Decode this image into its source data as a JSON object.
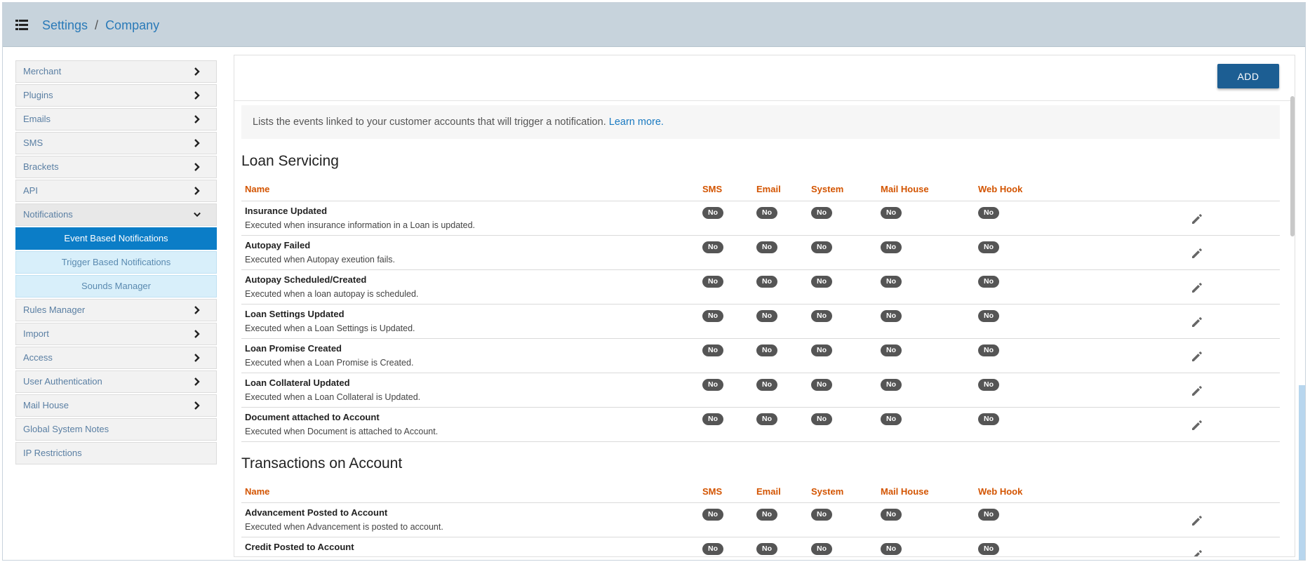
{
  "breadcrumb": {
    "root": "Settings",
    "separator": "/",
    "current": "Company"
  },
  "sidebar": {
    "items": [
      {
        "label": "Merchant",
        "chevron": "right"
      },
      {
        "label": "Plugins",
        "chevron": "right"
      },
      {
        "label": "Emails",
        "chevron": "right"
      },
      {
        "label": "SMS",
        "chevron": "right"
      },
      {
        "label": "Brackets",
        "chevron": "right"
      },
      {
        "label": "API",
        "chevron": "right"
      },
      {
        "label": "Notifications",
        "chevron": "down"
      }
    ],
    "sub_items": [
      {
        "label": "Event Based Notifications",
        "active": true
      },
      {
        "label": "Trigger Based Notifications",
        "active": false
      },
      {
        "label": "Sounds Manager",
        "active": false
      }
    ],
    "items_after": [
      {
        "label": "Rules Manager",
        "chevron": "right"
      },
      {
        "label": "Import",
        "chevron": "right"
      },
      {
        "label": "Access",
        "chevron": "right"
      },
      {
        "label": "User Authentication",
        "chevron": "right"
      },
      {
        "label": "Mail House",
        "chevron": "right"
      },
      {
        "label": "Global System Notes",
        "chevron": ""
      },
      {
        "label": "IP Restrictions",
        "chevron": ""
      }
    ]
  },
  "main": {
    "add_label": "ADD",
    "info_text": "Lists the events linked to your customer accounts that will trigger a notification.",
    "learn_more": "Learn more.",
    "columns": [
      "Name",
      "SMS",
      "Email",
      "System",
      "Mail House",
      "Web Hook"
    ],
    "sections": [
      {
        "title": "Loan Servicing",
        "rows": [
          {
            "title": "Insurance Updated",
            "desc": "Executed when insurance information in a Loan is updated.",
            "values": [
              "No",
              "No",
              "No",
              "No",
              "No"
            ]
          },
          {
            "title": "Autopay Failed",
            "desc": "Executed when Autopay exeution fails.",
            "values": [
              "No",
              "No",
              "No",
              "No",
              "No"
            ]
          },
          {
            "title": "Autopay Scheduled/Created",
            "desc": "Executed when a loan autopay is scheduled.",
            "values": [
              "No",
              "No",
              "No",
              "No",
              "No"
            ]
          },
          {
            "title": "Loan Settings Updated",
            "desc": "Executed when a Loan Settings is Updated.",
            "values": [
              "No",
              "No",
              "No",
              "No",
              "No"
            ]
          },
          {
            "title": "Loan Promise Created",
            "desc": "Executed when a Loan Promise is Created.",
            "values": [
              "No",
              "No",
              "No",
              "No",
              "No"
            ]
          },
          {
            "title": "Loan Collateral Updated",
            "desc": "Executed when a Loan Collateral is Updated.",
            "values": [
              "No",
              "No",
              "No",
              "No",
              "No"
            ]
          },
          {
            "title": "Document attached to Account",
            "desc": "Executed when Document is attached to Account.",
            "values": [
              "No",
              "No",
              "No",
              "No",
              "No"
            ]
          }
        ]
      },
      {
        "title": "Transactions on Account",
        "rows": [
          {
            "title": "Advancement Posted to Account",
            "desc": "Executed when Advancement is posted to account.",
            "values": [
              "No",
              "No",
              "No",
              "No",
              "No"
            ]
          },
          {
            "title": "Credit Posted to Account",
            "desc": "",
            "values": [
              "No",
              "No",
              "No",
              "No",
              "No"
            ]
          }
        ]
      }
    ]
  },
  "colors": {
    "topbar": "#c7d3dc",
    "link": "#2a7ab8",
    "active": "#0b7dc7",
    "header_text": "#d35400",
    "badge": "#555555",
    "button": "#1c5e93"
  },
  "icons": {
    "menu": "list-icon",
    "chevron_right": "chevron-right-icon",
    "chevron_down": "chevron-down-icon",
    "edit": "pencil-icon"
  }
}
